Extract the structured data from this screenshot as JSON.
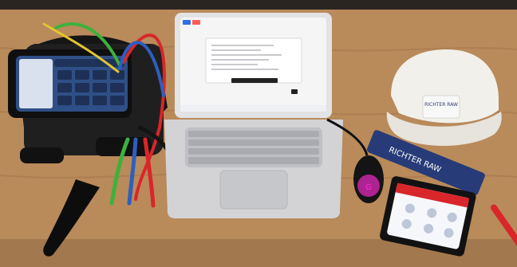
{
  "colors": {
    "desk": "#b98a5a",
    "wall": "#2b2522",
    "tester_body": "#1f1f1f",
    "tablet_screen": "#2f4f86",
    "laptop_body": "#cfcfd2",
    "laptop_screen": "#f5f5f6",
    "hardhat": "#f1f0ea",
    "mouse_accent": "#ff2bd5",
    "box_blue": "#273b78",
    "lead_red": "#d9262a",
    "lead_blue": "#2e5fbf",
    "lead_green": "#3db13c",
    "lead_yellow": "#e1c52f"
  },
  "laptop_screen": {
    "main_button_label": "",
    "secondary_button_label": ""
  },
  "hardhat": {
    "logo_text": "RICHTER RAW",
    "logo_subtext": ""
  },
  "box": {
    "logo_text": "RICHTER RAW"
  },
  "booklet": {
    "title": ""
  }
}
